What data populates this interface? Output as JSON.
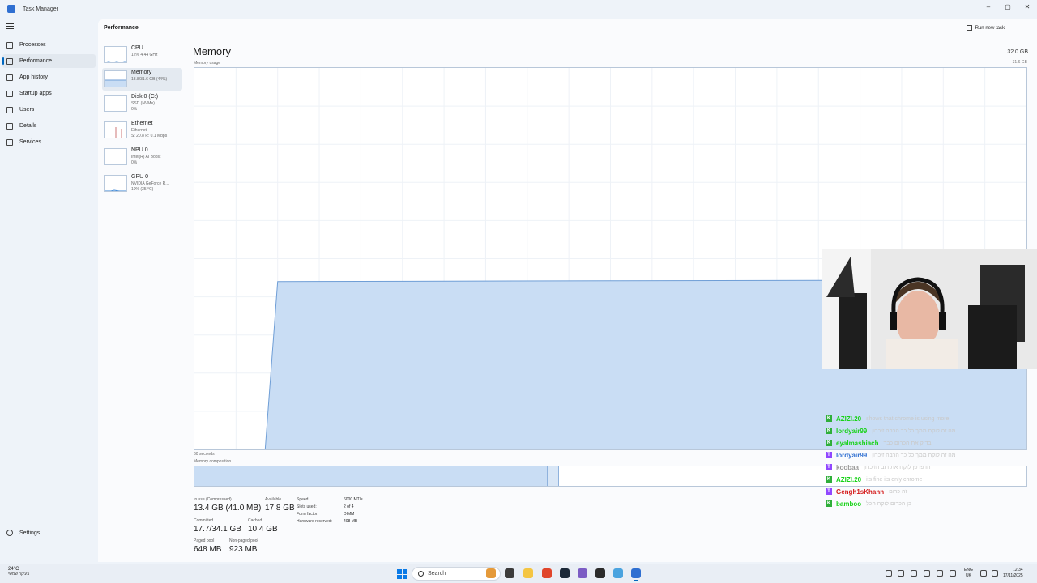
{
  "window": {
    "title": "Task Manager",
    "controls": [
      "–",
      "▢",
      "✕"
    ]
  },
  "nav": {
    "items": [
      {
        "label": "Processes",
        "icon": "grid-icon"
      },
      {
        "label": "Performance",
        "icon": "performance-icon",
        "active": true
      },
      {
        "label": "App history",
        "icon": "history-icon"
      },
      {
        "label": "Startup apps",
        "icon": "startup-icon"
      },
      {
        "label": "Users",
        "icon": "users-icon"
      },
      {
        "label": "Details",
        "icon": "list-icon"
      },
      {
        "label": "Services",
        "icon": "services-icon"
      }
    ],
    "settings_label": "Settings"
  },
  "header": {
    "title": "Performance",
    "run_new_task": "Run new task",
    "more": "···"
  },
  "devices": [
    {
      "name": "CPU",
      "line1": "12%  4.44 GHz",
      "line2": ""
    },
    {
      "name": "Memory",
      "line1": "13.8/31.6 GB (44%)",
      "line2": ""
    },
    {
      "name": "Disk 0 (C:)",
      "line1": "SSD (NVMe)",
      "line2": "0%"
    },
    {
      "name": "Ethernet",
      "line1": "Ethernet",
      "line2": "S: 20.8  R: 0.1 Mbps"
    },
    {
      "name": "NPU 0",
      "line1": "Intel(R) AI Boost",
      "line2": "0%"
    },
    {
      "name": "GPU 0",
      "line1": "NVIDIA GeForce R...",
      "line2": "10%  (35 °C)"
    }
  ],
  "memory": {
    "title": "Memory",
    "total": "32.0 GB",
    "usage_label": "Memory usage",
    "max_label": "31.6 GB",
    "seconds_label": "60 seconds",
    "composition_label": "Memory composition",
    "usage_fraction": 0.44,
    "in_use_fraction": 0.425,
    "modified_fraction": 0.013,
    "stats": {
      "in_use_label": "In use (Compressed)",
      "in_use": "13.4 GB (41.0 MB)",
      "available_label": "Available",
      "available": "17.8 GB",
      "committed_label": "Committed",
      "committed": "17.7/34.1 GB",
      "cached_label": "Cached",
      "cached": "10.4 GB",
      "paged_label": "Paged pool",
      "paged": "648 MB",
      "nonpaged_label": "Non-paged pool",
      "nonpaged": "923 MB"
    },
    "specs": [
      {
        "k": "Speed:",
        "v": "6000 MT/s"
      },
      {
        "k": "Slots used:",
        "v": "2 of 4"
      },
      {
        "k": "Form factor:",
        "v": "DIMM"
      },
      {
        "k": "Hardware reserved:",
        "v": "408 MB"
      }
    ]
  },
  "chat": [
    {
      "badge": "K",
      "user": "AZIZI.20",
      "color": "#19d219",
      "msg": "shows that chrome is using more",
      "platform": "kick"
    },
    {
      "badge": "K",
      "user": "lordyair99",
      "color": "#19d219",
      "msg": "מה זה לוקח ממך כל כך הרבה זיכרון",
      "platform": "kick"
    },
    {
      "badge": "K",
      "user": "eyalmashiach",
      "color": "#19d219",
      "msg": "בדוק את הכרום כבר",
      "platform": "kick"
    },
    {
      "badge": "T",
      "user": "lordyair99",
      "color": "#2f6fd1",
      "msg": "מה זה לוקח ממך כל כך הרבה זיכרון",
      "platform": "twitch"
    },
    {
      "badge": "T",
      "user": "koobaa",
      "color": "#9a9a9a",
      "msg": "הדפדפן לוקח את רוב הזיכרון",
      "platform": "twitch"
    },
    {
      "badge": "K",
      "user": "AZIZI.20",
      "color": "#19d219",
      "msg": "its fine its only chrome",
      "platform": "kick"
    },
    {
      "badge": "T",
      "user": "Gengh1sKhann",
      "color": "#d41919",
      "msg": "זה כרום",
      "platform": "twitch"
    },
    {
      "badge": "K",
      "user": "bamboo",
      "color": "#19d219",
      "msg": "כן הכרום לוקח הכל",
      "platform": "kick"
    }
  ],
  "taskbar": {
    "weather_temp": "24°C",
    "weather_desc": "בעיקר שמשי",
    "search_label": "Search",
    "lang_top": "ENG",
    "lang_bottom": "UK",
    "time": "12:34",
    "date": "17/11/2025"
  }
}
